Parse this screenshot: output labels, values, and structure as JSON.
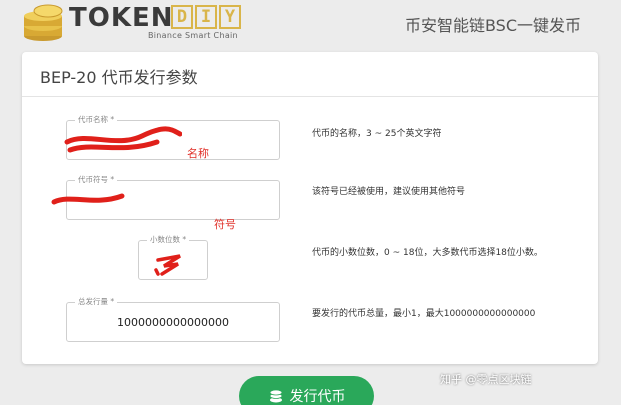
{
  "header": {
    "logo_text": "TOKEN",
    "logo_diy": [
      "D",
      "I",
      "Y"
    ],
    "logo_subtitle": "Binance Smart Chain",
    "title": "币安智能链BSC一键发币"
  },
  "card": {
    "title": "BEP-20 代币发行参数",
    "fields": [
      {
        "label": "代币名称 *",
        "value": "",
        "hint": "代币的名称，3 ~ 25个英文字符"
      },
      {
        "label": "代币符号 *",
        "value": "",
        "hint": "该符号已经被使用，建议使用其他符号"
      },
      {
        "label": "小数位数 *",
        "value": "",
        "hint": "代币的小数位数，0 ~ 18位，大多数代币选择18位小数。"
      },
      {
        "label": "总发行量 *",
        "value": "1000000000000000",
        "hint": "要发行的代币总量，最小1，最大1000000000000000"
      }
    ],
    "annotations": {
      "name": "名称",
      "symbol": "符号"
    }
  },
  "submit": {
    "label": "发行代币"
  },
  "watermark": "知乎 @零点区块链",
  "colors": {
    "accent": "#2aa85a",
    "logo_gold": "#d9b54a",
    "annotation": "#e0312a"
  }
}
